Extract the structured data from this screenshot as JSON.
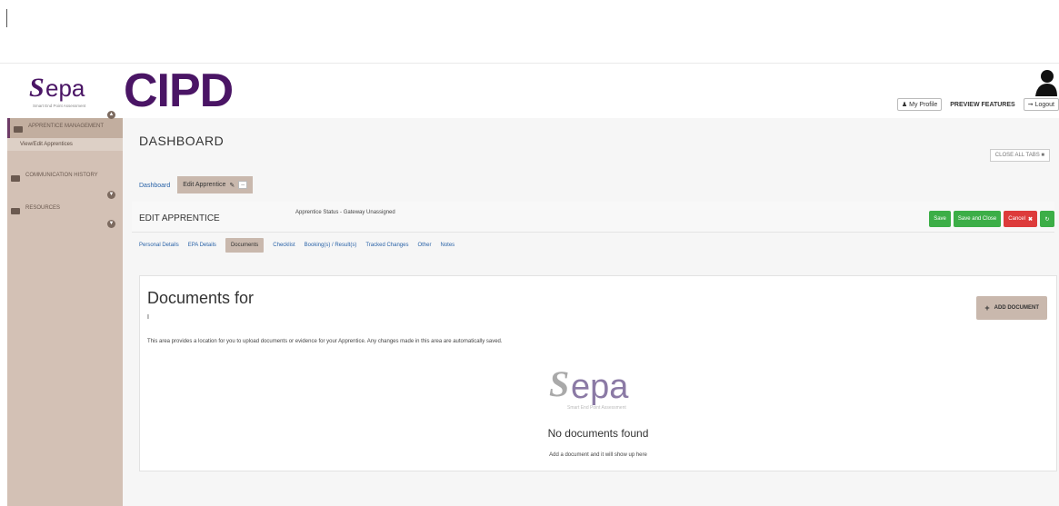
{
  "brand": {
    "sepa_word": "sepa",
    "sepa_tagline": "Smart End Point Assessment",
    "cipd_word": "CIPD",
    "accent_color": "#4a1565"
  },
  "header": {
    "my_profile": "My Profile",
    "preview_features": "PREVIEW FEATURES",
    "logout": "Logout",
    "user_icon": "user-silhouette-icon"
  },
  "sidebar": {
    "items": [
      {
        "label": "APPRENTICE MANAGEMENT",
        "icon": "people-icon",
        "active": true
      },
      {
        "label": "COMMUNICATION HISTORY",
        "icon": "chat-icon",
        "active": false
      },
      {
        "label": "RESOURCES",
        "icon": "folder-icon",
        "active": false
      }
    ],
    "sub_item": "View/Edit Apprentices"
  },
  "dashboard": {
    "title": "DASHBOARD",
    "close_all_tabs": "CLOSE ALL TABS"
  },
  "top_tabs": [
    {
      "label": "Dashboard",
      "active": false
    },
    {
      "label": "Edit Apprentice",
      "active": true
    }
  ],
  "edit": {
    "title": "EDIT APPRENTICE",
    "status": "Apprentice Status - Gateway Unassigned",
    "buttons": {
      "save": "Save",
      "save_close": "Save and Close",
      "cancel": "Cancel"
    }
  },
  "sub_tabs": [
    {
      "label": "Personal Details",
      "active": false
    },
    {
      "label": "EPA Details",
      "active": false
    },
    {
      "label": "Documents",
      "active": true
    },
    {
      "label": "Checklist",
      "active": false
    },
    {
      "label": "Booking(s) / Result(s)",
      "active": false
    },
    {
      "label": "Tracked Changes",
      "active": false
    },
    {
      "label": "Other",
      "active": false
    },
    {
      "label": "Notes",
      "active": false
    }
  ],
  "documents": {
    "heading": "Documents for",
    "subheading": "I",
    "add_button": "ADD DOCUMENT",
    "description": "This area provides a location for you to upload documents or evidence for your Apprentice. Any changes made in this area are automatically saved.",
    "empty_title": "No documents found",
    "empty_sub": "Add a document and it will show up here"
  },
  "colors": {
    "sidebar_bg": "#d3c1b5",
    "tab_active_bg": "#c9b8ad",
    "green": "#3cae47",
    "red": "#dd3b3b",
    "link": "#2a63a8"
  }
}
